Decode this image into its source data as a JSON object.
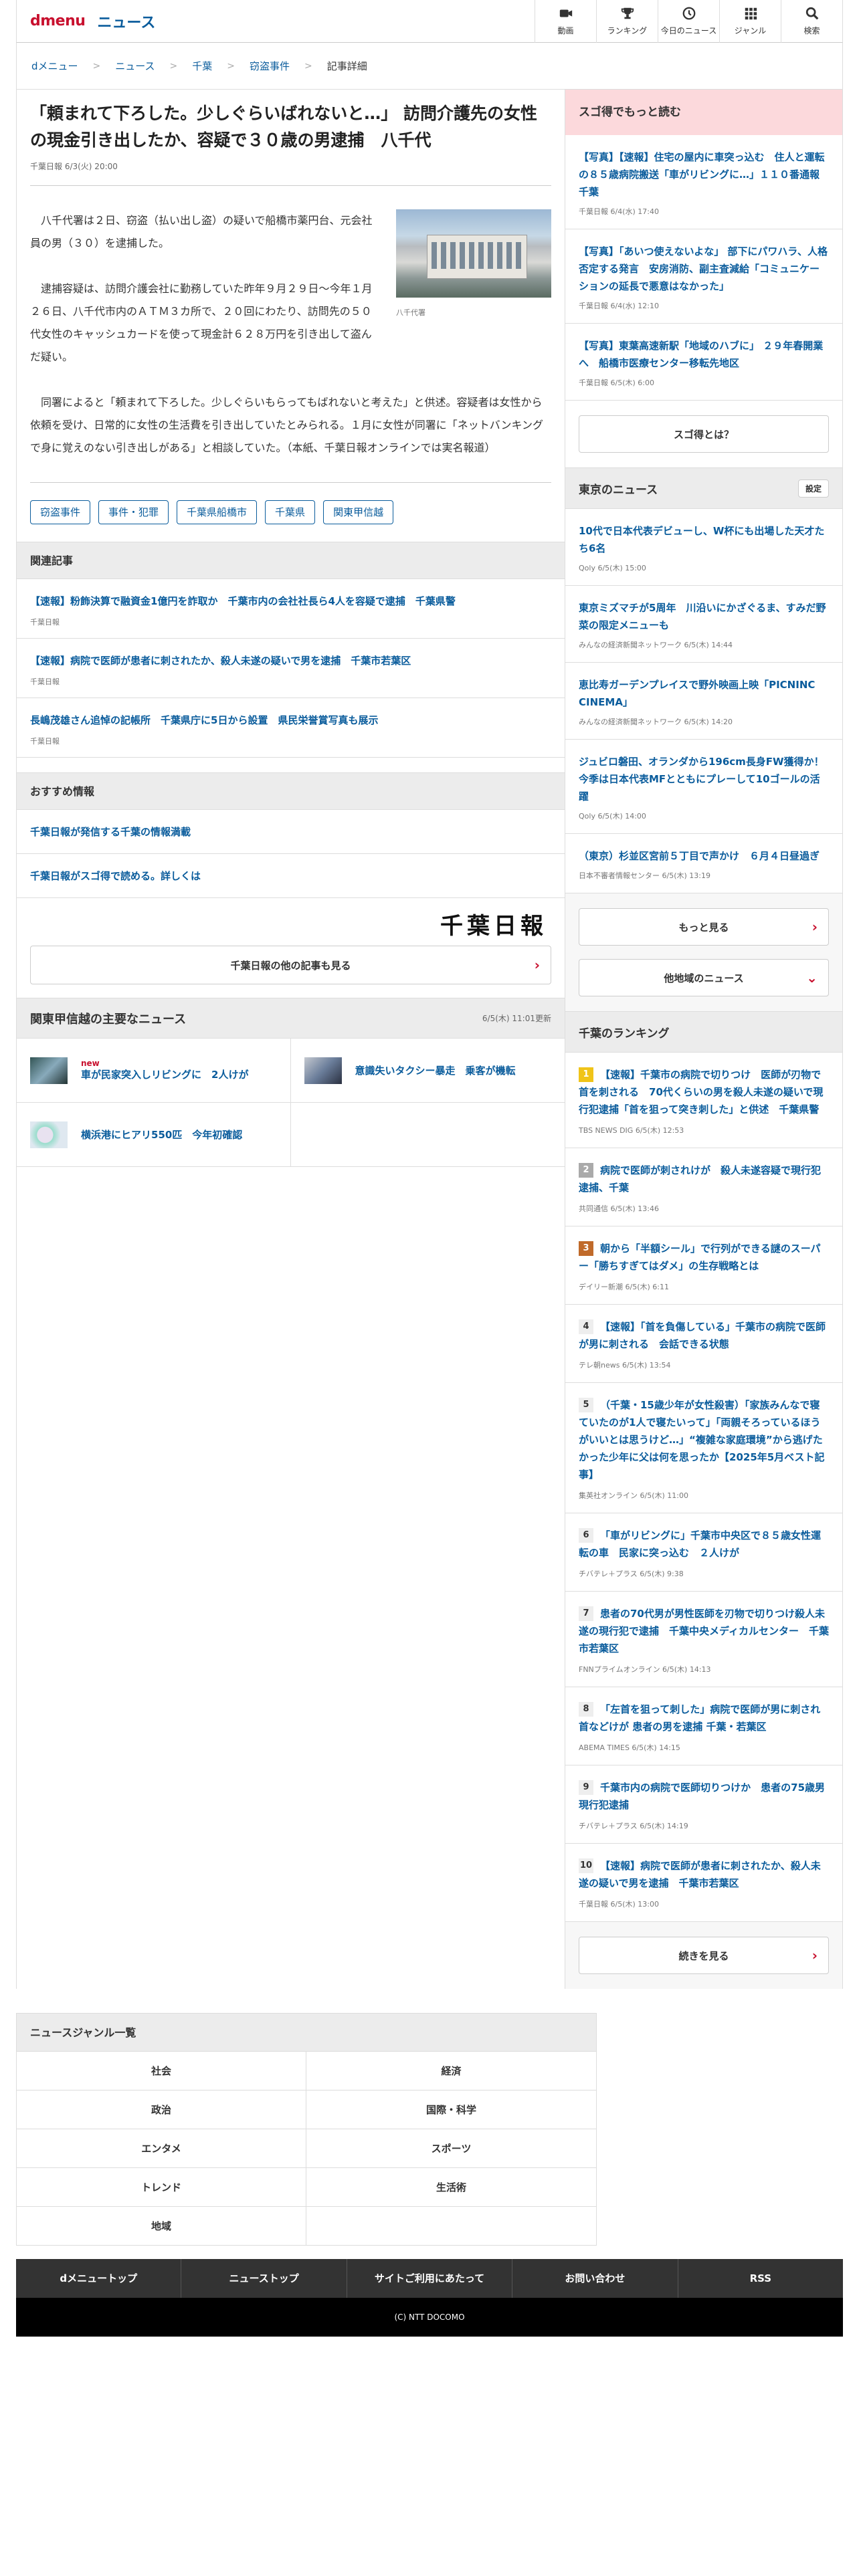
{
  "header": {
    "logo": "dmenu",
    "section": "ニュース",
    "nav": [
      {
        "label": "動画",
        "icon": "video-icon"
      },
      {
        "label": "ランキング",
        "icon": "trophy-icon"
      },
      {
        "label": "今日のニュース",
        "icon": "clock-icon"
      },
      {
        "label": "ジャンル",
        "icon": "grid-icon"
      },
      {
        "label": "検索",
        "icon": "search-icon"
      }
    ]
  },
  "breadcrumb": [
    "dメニュー",
    "ニュース",
    "千葉",
    "窃盗事件",
    "記事詳細"
  ],
  "article": {
    "title": "「頼まれて下ろした。少しぐらいばれないと…」 訪問介護先の女性の現金引き出したか、容疑で３０歳の男逮捕　八千代",
    "source": "千葉日報 6/3(火) 20:00",
    "photo_caption": "八千代署",
    "paragraphs": [
      "八千代署は２日、窃盗（払い出し盗）の疑いで船橋市薬円台、元会社員の男（３０）を逮捕した。",
      "逮捕容疑は、訪問介護会社に勤務していた昨年９月２９日～今年１月２６日、八千代市内のＡＴＭ３カ所で、２０回にわたり、訪問先の５０代女性のキャッシュカードを使って現金計６２８万円を引き出して盗んだ疑い。",
      "同署によると「頼まれて下ろした。少しぐらいもらってもばれないと考えた」と供述。容疑者は女性から依頼を受け、日常的に女性の生活費を引き出していたとみられる。１月に女性が同署に「ネットバンキングで身に覚えのない引き出しがある」と相談していた。（本紙、千葉日報オンラインでは実名報道）"
    ],
    "tags": [
      "窃盗事件",
      "事件・犯罪",
      "千葉県船橋市",
      "千葉県",
      "関東甲信越"
    ]
  },
  "related": {
    "heading": "関連記事",
    "items": [
      {
        "title": "【速報】粉飾決算で融資金1億円を詐取か　千葉市内の会社社長ら4人を容疑で逮捕　千葉県警",
        "source": "千葉日報"
      },
      {
        "title": "【速報】病院で医師が患者に刺されたか、殺人未遂の疑いで男を逮捕　千葉市若葉区",
        "source": "千葉日報"
      },
      {
        "title": "長嶋茂雄さん追悼の記帳所　千葉県庁に5日から設置　県民栄誉賞写真も展示",
        "source": "千葉日報"
      }
    ]
  },
  "recommended": {
    "heading": "おすすめ情報",
    "items": [
      "千葉日報が発信する千葉の情報満載",
      "千葉日報がスゴ得で読める。詳しくは"
    ]
  },
  "chiba": {
    "logo_text": "千葉日報",
    "more_label": "千葉日報の他の記事も見る"
  },
  "major": {
    "heading": "関東甲信越の主要なニュース",
    "updated": "6/5(木) 11:01更新",
    "new_label": "new",
    "items": [
      {
        "title": "車が民家突入しリビングに　2人けが",
        "is_new": true
      },
      {
        "title": "意識失いタクシー暴走　乗客が機転",
        "is_new": false
      },
      {
        "title": "横浜港にヒアリ550匹　今年初確認",
        "is_new": false
      }
    ]
  },
  "sugo": {
    "heading": "スゴ得でもっと読む",
    "items": [
      {
        "title": "【写真】【速報】住宅の屋内に車突っ込む　住人と運転の８５歳病院搬送「車がリビングに…」１１０番通報　千葉",
        "source": "千葉日報 6/4(水) 17:40"
      },
      {
        "title": "【写真】「あいつ使えないよな」 部下にパワハラ、人格否定する発言　安房消防、副主査減給「コミュニケーションの延長で悪意はなかった」",
        "source": "千葉日報 6/4(水) 12:10"
      },
      {
        "title": "【写真】東葉高速新駅「地域のハブに」 ２９年春開業へ　船橋市医療センター移転先地区",
        "source": "千葉日報 6/5(木) 6:00"
      }
    ],
    "button": "スゴ得とは？"
  },
  "tokyo": {
    "heading": "東京のニュース",
    "settings": "設定",
    "items": [
      {
        "title": "10代で日本代表デビューし、W杯にも出場した天才たち6名",
        "source": "Qoly 6/5(木) 15:00"
      },
      {
        "title": "東京ミズマチが5周年　川沿いにかざぐるま、すみだ野菜の限定メニューも",
        "source": "みんなの経済新聞ネットワーク 6/5(木) 14:44"
      },
      {
        "title": "恵比寿ガーデンプレイスで野外映画上映「PICNINC CINEMA」",
        "source": "みんなの経済新聞ネットワーク 6/5(木) 14:20"
      },
      {
        "title": "ジュビロ磐田、オランダから196cm長身FW獲得か！今季は日本代表MFとともにプレーして10ゴールの活躍",
        "source": "Qoly 6/5(木) 14:00"
      },
      {
        "title": "（東京）杉並区宮前５丁目で声かけ　６月４日昼過ぎ",
        "source": "日本不審者情報センター 6/5(木) 13:19"
      }
    ],
    "more": "もっと見る",
    "other": "他地域のニュース"
  },
  "ranking": {
    "heading": "千葉のランキング",
    "items": [
      {
        "rank": "1",
        "title": "【速報】千葉市の病院で切りつけ　医師が刃物で首を刺される　70代くらいの男を殺人未遂の疑いで現行犯逮捕「首を狙って突き刺した」と供述　千葉県警",
        "source": "TBS NEWS DIG 6/5(木) 12:53"
      },
      {
        "rank": "2",
        "title": "病院で医師が刺されけが　殺人未遂容疑で現行犯逮捕、千葉",
        "source": "共同通信 6/5(木) 13:46"
      },
      {
        "rank": "3",
        "title": "朝から「半額シール」で行列ができる謎のスーパー「勝ちすぎてはダメ」の生存戦略とは",
        "source": "デイリー新潮 6/5(木) 6:11"
      },
      {
        "rank": "4",
        "title": "【速報】「首を負傷している」千葉市の病院で医師が男に刺される　会話できる状態",
        "source": "テレ朝news 6/5(木) 13:54"
      },
      {
        "rank": "5",
        "title": "（千葉・15歳少年が女性殺害）「家族みんなで寝ていたのが1人で寝たいって」「両親そろっているほうがいいとは思うけど…」“複雑な家庭環境”から逃げたかった少年に父は何を思ったか【2025年5月ベスト記事】",
        "source": "集英社オンライン 6/5(木) 11:00"
      },
      {
        "rank": "6",
        "title": "「車がリビングに」千葉市中央区で８５歳女性運転の車　民家に突っ込む　２人けが",
        "source": "チバテレ＋プラス 6/5(木) 9:38"
      },
      {
        "rank": "7",
        "title": "患者の70代男が男性医師を刃物で切りつけ殺人未遂の現行犯で逮捕　千葉中央メディカルセンター　千葉市若葉区",
        "source": "FNNプライムオンライン 6/5(木) 14:13"
      },
      {
        "rank": "8",
        "title": "「左首を狙って刺した」病院で医師が男に刺され首などけが 患者の男を逮捕 千葉・若葉区",
        "source": "ABEMA TIMES 6/5(木) 14:15"
      },
      {
        "rank": "9",
        "title": "千葉市内の病院で医師切りつけか　患者の75歳男現行犯逮捕",
        "source": "チバテレ＋プラス 6/5(木) 14:19"
      },
      {
        "rank": "10",
        "title": "【速報】病院で医師が患者に刺されたか、殺人未遂の疑いで男を逮捕　千葉市若葉区",
        "source": "千葉日報 6/5(木) 13:00"
      }
    ],
    "more": "続きを見る"
  },
  "genre": {
    "heading": "ニュースジャンル一覧",
    "items": [
      "社会",
      "経済",
      "政治",
      "国際・科学",
      "エンタメ",
      "スポーツ",
      "トレンド",
      "生活術",
      "地域"
    ]
  },
  "footer": {
    "links": [
      "dメニュートップ",
      "ニューストップ",
      "サイトご利用にあたって",
      "お問い合わせ",
      "RSS"
    ],
    "copyright": "(C) NTT DOCOMO"
  }
}
